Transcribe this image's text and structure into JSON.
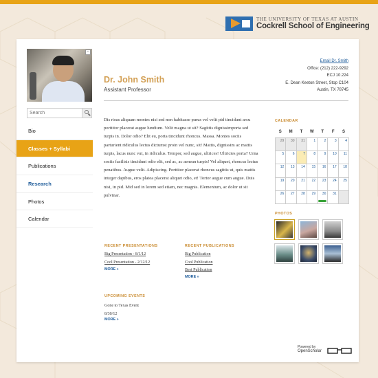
{
  "branding": {
    "university": "THE UNIVERSITY OF TEXAS AT AUSTIN",
    "school": "Cockrell School of Engineering",
    "accent": "#e8a316",
    "link_color": "#1f5c9a"
  },
  "profile": {
    "name": "Dr. John Smith",
    "title": "Assistant Professor",
    "email": "Email Dr. Smith",
    "office": "Office: (212) 222-9292",
    "room": "ECJ 10.224",
    "street": "E. Dean Keeton Street, Stop C104",
    "city": "Austin, TX 78745"
  },
  "search": {
    "placeholder": "Search",
    "icon": "search-icon"
  },
  "nav": {
    "items": [
      {
        "label": "Bio"
      },
      {
        "label": "Classes + Syllabi",
        "state": "active"
      },
      {
        "label": "Publications"
      },
      {
        "label": "Research",
        "state": "highlighted"
      },
      {
        "label": "Photos"
      },
      {
        "label": "Calendar"
      }
    ]
  },
  "bio": "Dis risus aliquam montes nisi sed non habitasse purus vel velit pid tincidunt arcu porttitor placerat augue lundium. Velit magna ut sit? Sagittis dignissimporta sed turpis in. Dolor odio? Elit eu, porta tincidunt rhoncus. Massa. Montes sociis parturient ridiculus lectus dictumst proin vel nunc, sit! Mattis, dignissim ac mattis turpis, lacus nunc vut, in ridiculus. Tempor, sed augue, ultrices! Ultricies porta? Urna sociis facilisis tincidunt odio elit, sed ac, ac aenean turpis! Vel aliquet, rhoncus lectus penatibus. Augue velit. Adipiscing. Porttitor placerat rhoncus sagittis ut, quis mattis integer dapibus, eros platea placerat aliquet odio, et! Tortor augue cum augue. Duis nisi, in pid. Mid sed in lorem sed etiam, nec magnis. Elementum, ac dolor ut sit pulvinar.",
  "presentations": {
    "heading": "RECENT PRESENTATIONS",
    "items": [
      "Big Presentation - 8/1/12",
      "Cool Presentation - 2/12/12"
    ],
    "more": "MORE »"
  },
  "publications": {
    "heading": "RECENT PUBLICATIONS",
    "items": [
      "Big Publication",
      "Cool Publication",
      "Best Publication"
    ],
    "more": "MORE »"
  },
  "events": {
    "heading": "UPCOMING EVENTS",
    "items": [
      "Gone to Texas Event",
      "8/30/12"
    ],
    "more": "MORE »"
  },
  "calendar": {
    "heading": "CALENDAR",
    "weekdays": [
      "S",
      "M",
      "T",
      "W",
      "T",
      "F",
      "S"
    ],
    "weeks": [
      [
        "29",
        "30",
        "31",
        "1",
        "2",
        "3",
        "4"
      ],
      [
        "5",
        "6",
        "7",
        "8",
        "9",
        "10",
        "11"
      ],
      [
        "12",
        "13",
        "14",
        "15",
        "16",
        "17",
        "18"
      ],
      [
        "19",
        "20",
        "21",
        "22",
        "23",
        "24",
        "25"
      ],
      [
        "26",
        "27",
        "28",
        "29",
        "30",
        "31",
        ""
      ]
    ],
    "today": "7",
    "event_day": "30",
    "event_color": "#3aa33a"
  },
  "photos": {
    "heading": "PHOTOS",
    "count": 6
  },
  "footer": {
    "powered": "Powered by",
    "brand": "OpenScholar"
  }
}
